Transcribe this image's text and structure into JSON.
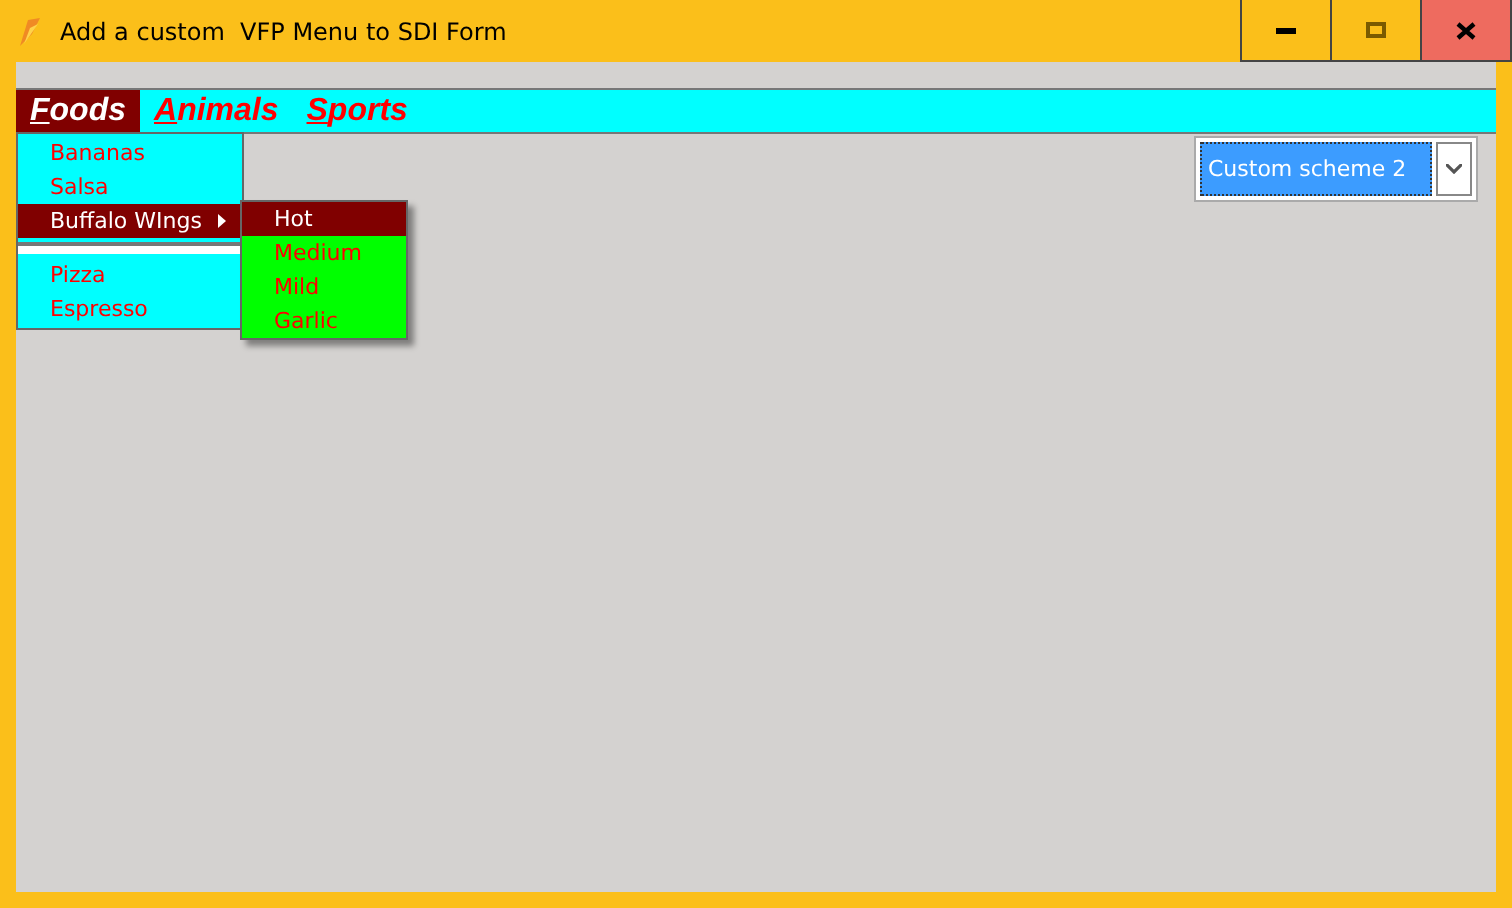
{
  "window": {
    "title": "Add a custom  VFP Menu to SDI Form"
  },
  "menu_bar": [
    {
      "label": "Foods",
      "selected": true
    },
    {
      "label": "Animals",
      "selected": false
    },
    {
      "label": "Sports",
      "selected": false
    }
  ],
  "dropdown": [
    {
      "kind": "item",
      "label": "Bananas",
      "selected": false
    },
    {
      "kind": "item",
      "label": "Salsa",
      "selected": false
    },
    {
      "kind": "submenu",
      "label": "Buffalo WIngs",
      "selected": true
    },
    {
      "kind": "separator"
    },
    {
      "kind": "item",
      "label": "Pizza",
      "selected": false
    },
    {
      "kind": "item",
      "label": "Espresso",
      "selected": false
    }
  ],
  "submenu": [
    {
      "label": "Hot",
      "selected": true
    },
    {
      "label": "Medium",
      "selected": false
    },
    {
      "label": "Mild",
      "selected": false
    },
    {
      "label": "Garlic",
      "selected": false
    }
  ],
  "scheme_select": {
    "value": "Custom scheme 2"
  }
}
